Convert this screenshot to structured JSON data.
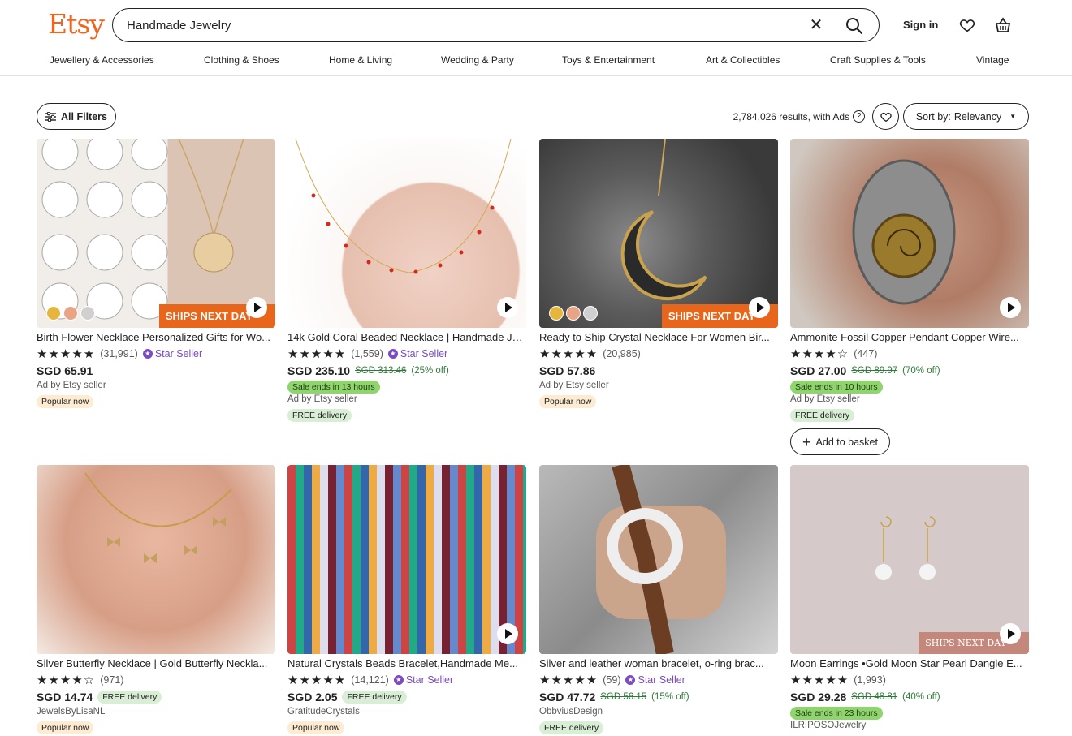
{
  "brand": "Etsy",
  "search": {
    "value": "Handmade Jewelry"
  },
  "header": {
    "sign_in": "Sign in"
  },
  "nav": [
    "Jewellery & Accessories",
    "Clothing & Shoes",
    "Home & Living",
    "Wedding & Party",
    "Toys & Entertainment",
    "Art & Collectibles",
    "Craft Supplies & Tools",
    "Vintage"
  ],
  "toolbar": {
    "filters_label": "All Filters",
    "results_text": "2,784,026 results, with Ads",
    "sort_prefix": "Sort by:",
    "sort_value": "Relevancy"
  },
  "colors": {
    "brand": "#f1641e",
    "star_seller": "#7a4cc0",
    "sale": "#8fd46c"
  },
  "listings": [
    {
      "title": "Birth Flower Necklace Personalized Gifts for Wo...",
      "stars": "★★★★★",
      "count": "(31,991)",
      "star_seller": "Star Seller",
      "price": "SGD 65.91",
      "seller": "Ad by Etsy seller",
      "badge": "Popular now",
      "ships_badge": "SHIPS NEXT DAY"
    },
    {
      "title": "14k Gold Coral Beaded Necklace | Handmade Je...",
      "stars": "★★★★★",
      "count": "(1,559)",
      "star_seller": "Star Seller",
      "price": "SGD 235.10",
      "old_price": "SGD 313.46",
      "discount": "(25% off)",
      "sale": "Sale ends in 13 hours",
      "seller": "Ad by Etsy seller",
      "delivery": "FREE delivery"
    },
    {
      "title": "Ready to Ship Crystal Necklace For Women Bir...",
      "stars": "★★★★★",
      "count": "(20,985)",
      "price": "SGD 57.86",
      "seller": "Ad by Etsy seller",
      "badge": "Popular now",
      "ships_badge": "SHIPS NEXT DAY"
    },
    {
      "title": "Ammonite Fossil Copper Pendant Copper Wire...",
      "stars": "★★★★☆",
      "count": "(447)",
      "price": "SGD 27.00",
      "old_price": "SGD 89.97",
      "discount": "(70% off)",
      "sale": "Sale ends in 10 hours",
      "seller": "Ad by Etsy seller",
      "delivery": "FREE delivery",
      "basket": "Add to basket"
    },
    {
      "title": "Silver Butterfly Necklace | Gold Butterfly Neckla...",
      "stars": "★★★★☆",
      "count": "(971)",
      "price": "SGD 14.74",
      "delivery": "FREE delivery",
      "seller": "JewelsByLisaNL",
      "badge": "Popular now"
    },
    {
      "title": "Natural Crystals Beads Bracelet,Handmade Me...",
      "stars": "★★★★★",
      "count": "(14,121)",
      "star_seller": "Star Seller",
      "price": "SGD 2.05",
      "delivery": "FREE delivery",
      "seller": "GratitudeCrystals",
      "badge": "Popular now"
    },
    {
      "title": "Silver and leather woman bracelet, o-ring brac...",
      "stars": "★★★★★",
      "count": "(59)",
      "star_seller": "Star Seller",
      "price": "SGD 47.72",
      "old_price": "SGD 56.15",
      "discount": "(15% off)",
      "seller": "ObbviusDesign",
      "delivery": "FREE delivery"
    },
    {
      "title": "Moon Earrings •Gold Moon Star Pearl Dangle E...",
      "stars": "★★★★★",
      "count": "(1,993)",
      "price": "SGD 29.28",
      "old_price": "SGD 48.81",
      "discount": "(40% off)",
      "sale": "Sale ends in 23 hours",
      "seller": "ILRIPOSOJewelry",
      "ships_badge": "SHIPS NEXT DAY"
    }
  ]
}
